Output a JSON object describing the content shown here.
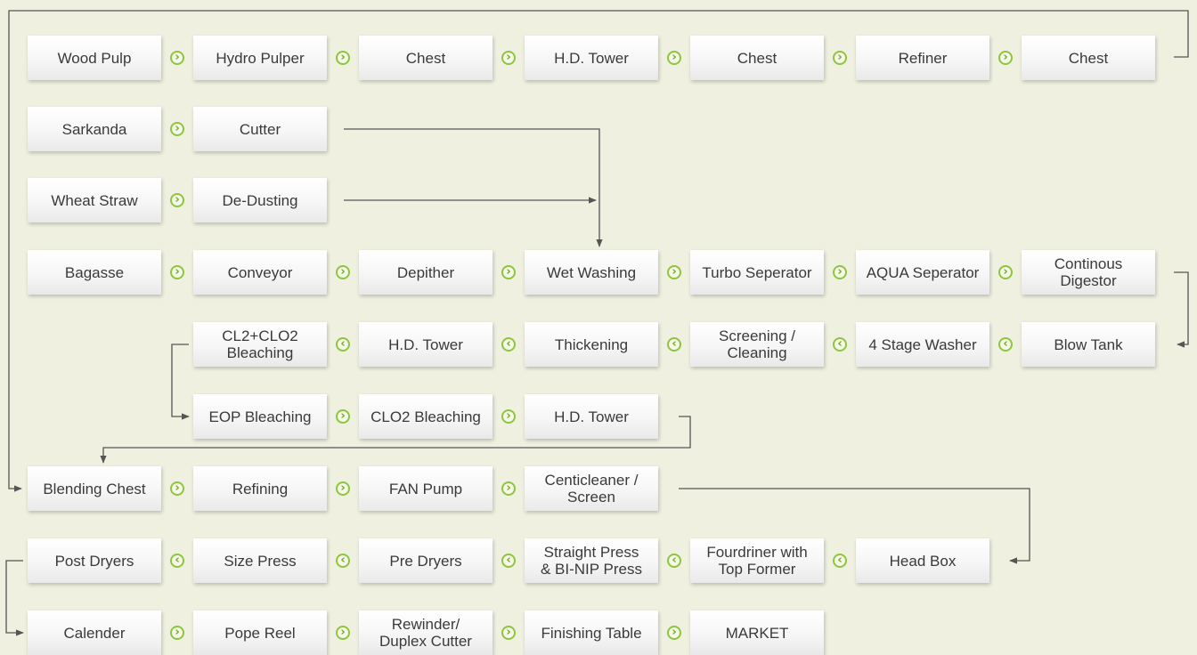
{
  "colors": {
    "background": "#eff0e0",
    "box_text": "#3a3a3a",
    "chevron_ring": "#8cc63f",
    "chevron_fill": "#f6f7e6",
    "line": "#555555"
  },
  "rows": [
    {
      "direction": "right",
      "boxes": [
        "Wood Pulp",
        "Hydro Pulper",
        "Chest",
        "H.D. Tower",
        "Chest",
        "Refiner",
        "Chest"
      ]
    },
    {
      "direction": "right",
      "boxes": [
        "Sarkanda",
        "Cutter"
      ]
    },
    {
      "direction": "right",
      "boxes": [
        "Wheat Straw",
        "De-Dusting"
      ]
    },
    {
      "direction": "right",
      "boxes": [
        "Bagasse",
        "Conveyor",
        "Depither",
        "Wet Washing",
        "Turbo Seperator",
        "AQUA Seperator",
        "Continous\nDigestor"
      ]
    },
    {
      "direction": "left",
      "boxes": [
        "CL2+CLO2\nBleaching",
        "H.D. Tower",
        "Thickening",
        "Screening /\nCleaning",
        "4 Stage Washer",
        "Blow Tank"
      ]
    },
    {
      "direction": "right",
      "boxes": [
        "EOP Bleaching",
        "CLO2 Bleaching",
        "H.D. Tower"
      ]
    },
    {
      "direction": "right",
      "boxes": [
        "Blending Chest",
        "Refining",
        "FAN Pump",
        "Centicleaner /\nScreen"
      ]
    },
    {
      "direction": "left",
      "boxes": [
        "Post Dryers",
        "Size Press",
        "Pre Dryers",
        "Straight Press\n& BI-NIP Press",
        "Fourdriner with\nTop Former",
        "Head Box"
      ]
    },
    {
      "direction": "right",
      "boxes": [
        "Calender",
        "Pope Reel",
        "Rewinder/\nDuplex Cutter",
        "Finishing Table",
        "MARKET"
      ]
    }
  ],
  "icons": {
    "chevron_right": "chevron-right-icon",
    "chevron_left": "chevron-left-icon"
  }
}
